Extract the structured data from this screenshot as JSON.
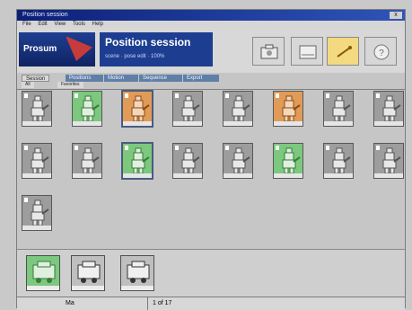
{
  "window": {
    "close_label": "x"
  },
  "menubar": {
    "items": [
      "File",
      "Edit",
      "View",
      "Tools",
      "Help"
    ]
  },
  "brand": {
    "name": "Prosum"
  },
  "app": {
    "title": "Position session",
    "subtitle": "scene · pose edit · 100%"
  },
  "tabs": {
    "items": [
      "Session",
      "Positions",
      "Motion",
      "Sequence",
      "Export"
    ],
    "subtabs": [
      "All",
      "Favorites"
    ]
  },
  "header_buttons": [
    "camera-icon",
    "capture-icon",
    "pose-icon",
    "help-icon"
  ],
  "tiles": [
    {
      "color": "gray"
    },
    {
      "color": "green"
    },
    {
      "color": "orange"
    },
    {
      "color": "gray"
    },
    {
      "color": "gray"
    },
    {
      "color": "orange"
    },
    {
      "color": "gray"
    },
    {
      "color": "gray"
    },
    {
      "color": "gray"
    },
    {
      "color": "gray"
    },
    {
      "color": "green"
    },
    {
      "color": "gray"
    },
    {
      "color": "gray"
    },
    {
      "color": "green"
    },
    {
      "color": "gray"
    },
    {
      "color": "gray"
    },
    {
      "color": "gray"
    }
  ],
  "lower_tiles": [
    {
      "color": "green"
    },
    {
      "color": "gray"
    },
    {
      "color": "gray"
    }
  ],
  "status": {
    "left": "Ma",
    "right": "1 of 17"
  },
  "colors": {
    "accent": "#1d3e90",
    "title_blue": "#0b1f78",
    "green": "#7bc87e",
    "orange": "#e19b58"
  }
}
